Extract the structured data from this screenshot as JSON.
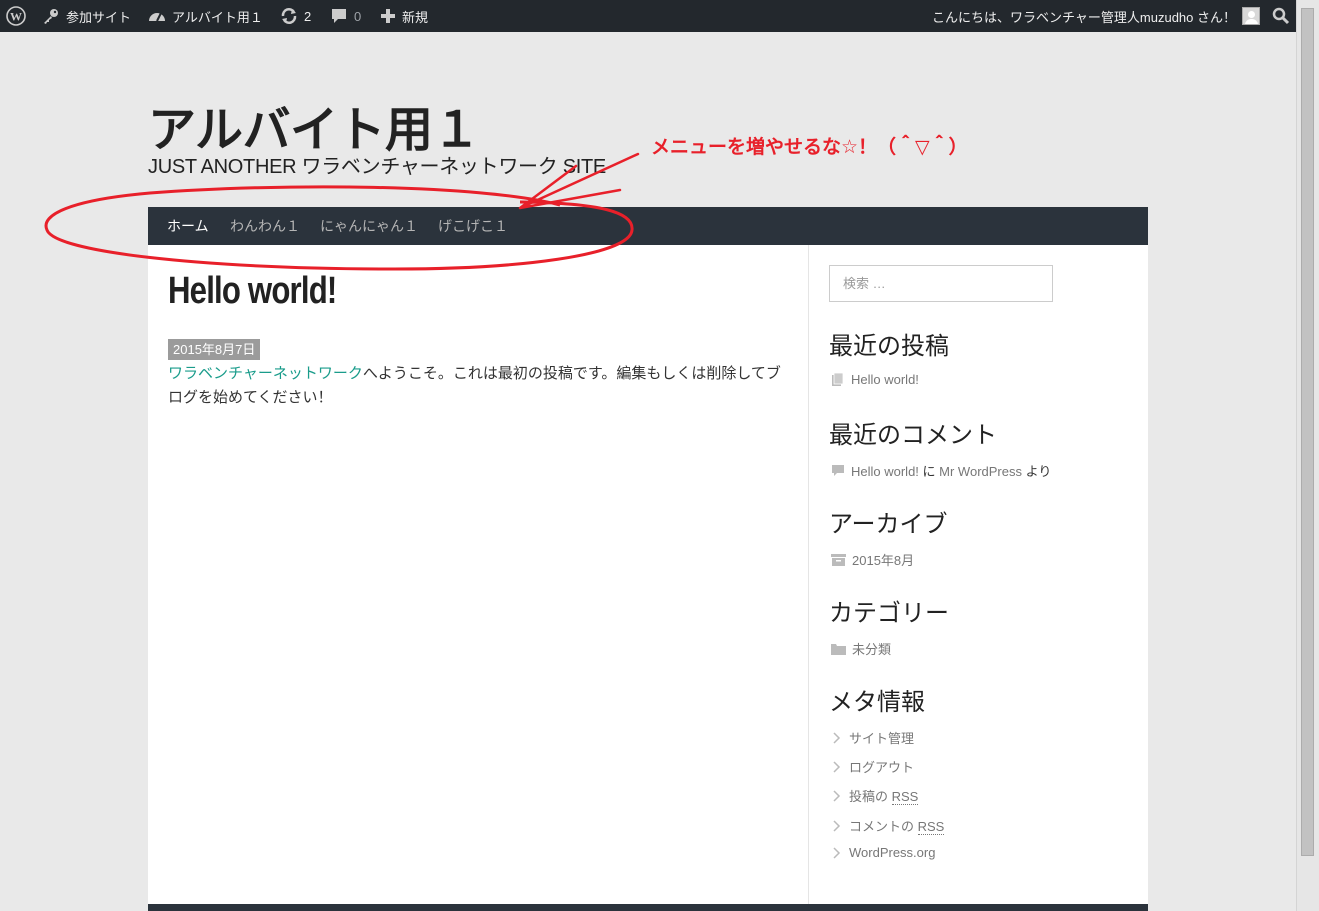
{
  "admin_bar": {
    "my_sites": "参加サイト",
    "site_name": "アルバイト用１",
    "updates_count": "2",
    "comments_count": "0",
    "new_label": "新規",
    "greeting": "こんにちは、ワラベンチャー管理人muzudho さん！"
  },
  "site": {
    "title": "アルバイト用１",
    "description": "JUST ANOTHER ワラベンチャーネットワーク SITE"
  },
  "nav": {
    "items": [
      {
        "label": "ホーム"
      },
      {
        "label": "わんわん１"
      },
      {
        "label": "にゃんにゃん１"
      },
      {
        "label": "げこげこ１"
      }
    ]
  },
  "post": {
    "title": "Hello world!",
    "date": "2015年8月7日",
    "link_text": "ワラベンチャーネットワーク",
    "body": "へようこそ。これは最初の投稿です。編集もしくは削除してブログを始めてください！"
  },
  "sidebar": {
    "search_placeholder": "検索 …",
    "recent_posts": {
      "title": "最近の投稿",
      "items": [
        "Hello world!"
      ]
    },
    "recent_comments": {
      "title": "最近のコメント",
      "post_link": "Hello world!",
      "on": " に ",
      "author": "Mr WordPress",
      "from": " より"
    },
    "archives": {
      "title": "アーカイブ",
      "items": [
        "2015年8月"
      ]
    },
    "categories": {
      "title": "カテゴリー",
      "items": [
        "未分類"
      ]
    },
    "meta": {
      "title": "メタ情報",
      "site_admin": "サイト管理",
      "logout": "ログアウト",
      "posts_rss_prefix": "投稿の ",
      "comments_rss_prefix": "コメントの ",
      "rss": "RSS",
      "wordpress_org": "WordPress.org"
    }
  },
  "annotation": {
    "text": "メニューを増やせるな☆！（＾▽＾）",
    "color": "#e8202a"
  },
  "colors": {
    "admin_bar": "#23282d",
    "nav": "#2b333c",
    "link": "#1a9c8b"
  }
}
